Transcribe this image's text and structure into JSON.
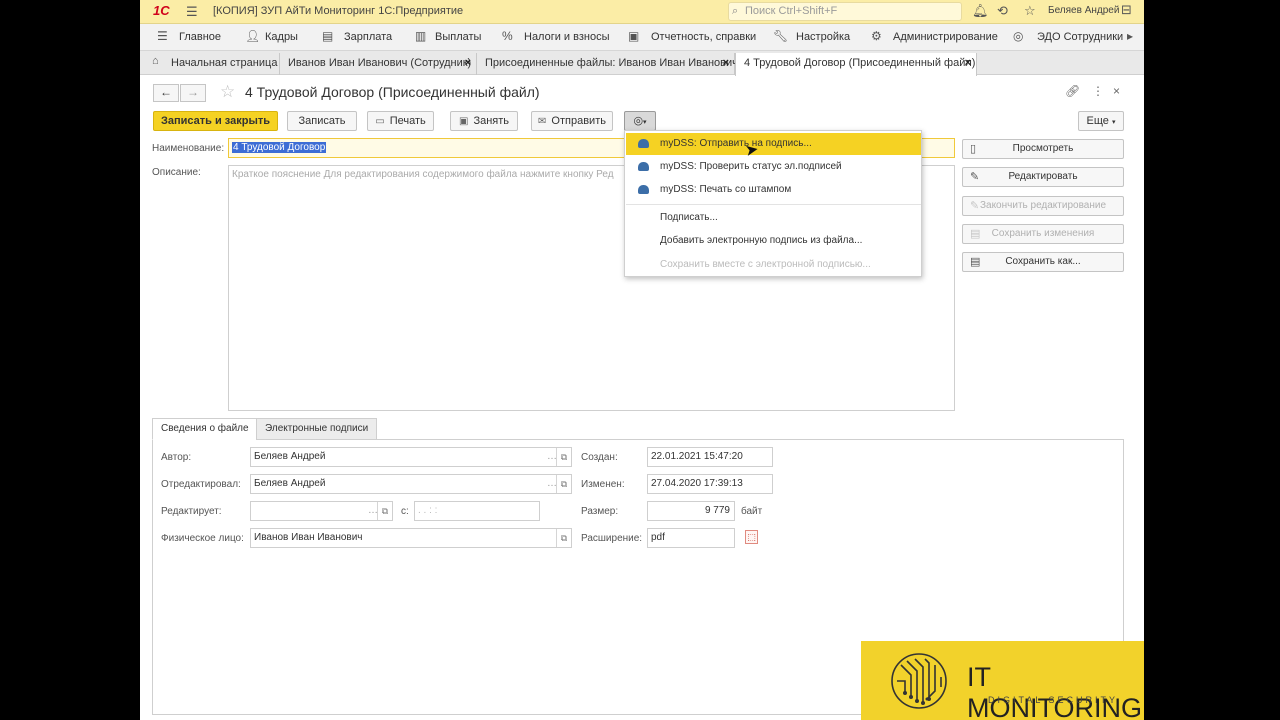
{
  "titlebar": {
    "logo": "1С",
    "title": "[КОПИЯ] ЗУП АйТи Мониторинг 1С:Предприятие",
    "search_placeholder": "Поиск Ctrl+Shift+F",
    "user": "Беляев Андрей"
  },
  "mainmenu": {
    "items": [
      "Главное",
      "Кадры",
      "Зарплата",
      "Выплаты",
      "Налоги и взносы",
      "Отчетность, справки",
      "Настройка",
      "Администрирование",
      "ЭДО Сотрудники"
    ]
  },
  "tabs": {
    "items": [
      "Начальная страница",
      "Иванов Иван Иванович (Сотрудник)",
      "Присоединенные файлы: Иванов Иван Иванович",
      "4 Трудовой Договор  (Присоединенный файл)"
    ]
  },
  "form": {
    "title": "4 Трудовой Договор  (Присоединенный файл)",
    "toolbar": {
      "save_close": "Записать и закрыть",
      "save": "Записать",
      "print": "Печать",
      "occupy": "Занять",
      "send": "Отправить",
      "more": "Еще"
    },
    "name_label": "Наименование:",
    "name_value": "4 Трудовой Договор",
    "desc_label": "Описание:",
    "desc_placeholder": "Краткое пояснение  Для редактирования содержимого файла нажмите кнопку Ред"
  },
  "dropdown": {
    "items": [
      "myDSS: Отправить на подпись...",
      "myDSS: Проверить статус  эл.подписей",
      "myDSS: Печать со штампом",
      "Подписать...",
      "Добавить электронную подпись из файла...",
      "Сохранить вместе с электронной подписью..."
    ]
  },
  "right_buttons": [
    "Просмотреть",
    "Редактировать",
    "Закончить редактирование",
    "Сохранить изменения",
    "Сохранить как..."
  ],
  "bottom": {
    "tabs": [
      "Сведения о файле",
      "Электронные подписи"
    ],
    "author_label": "Автор:",
    "author_value": "Беляев Андрей",
    "edited_label": "Отредактировал:",
    "edited_value": "Беляев Андрей",
    "editing_label": "Редактирует:",
    "editing_value": "",
    "since_label": "с:",
    "since_value": ".  .      :  :",
    "person_label": "Физическое лицо:",
    "person_value": "Иванов Иван Иванович",
    "created_label": "Создан:",
    "created_value": "22.01.2021 15:47:20",
    "modified_label": "Изменен:",
    "modified_value": "27.04.2020 17:39:13",
    "size_label": "Размер:",
    "size_value": "9 779",
    "size_unit": "байт",
    "ext_label": "Расширение:",
    "ext_value": "pdf"
  },
  "watermark": {
    "title": "IT MONITORING",
    "subtitle": "DIGITAL SECURITY"
  },
  "colors": {
    "accent": "#f5d223",
    "selection": "#3d6dd5",
    "cloud_icon": "#3c6ea8"
  }
}
